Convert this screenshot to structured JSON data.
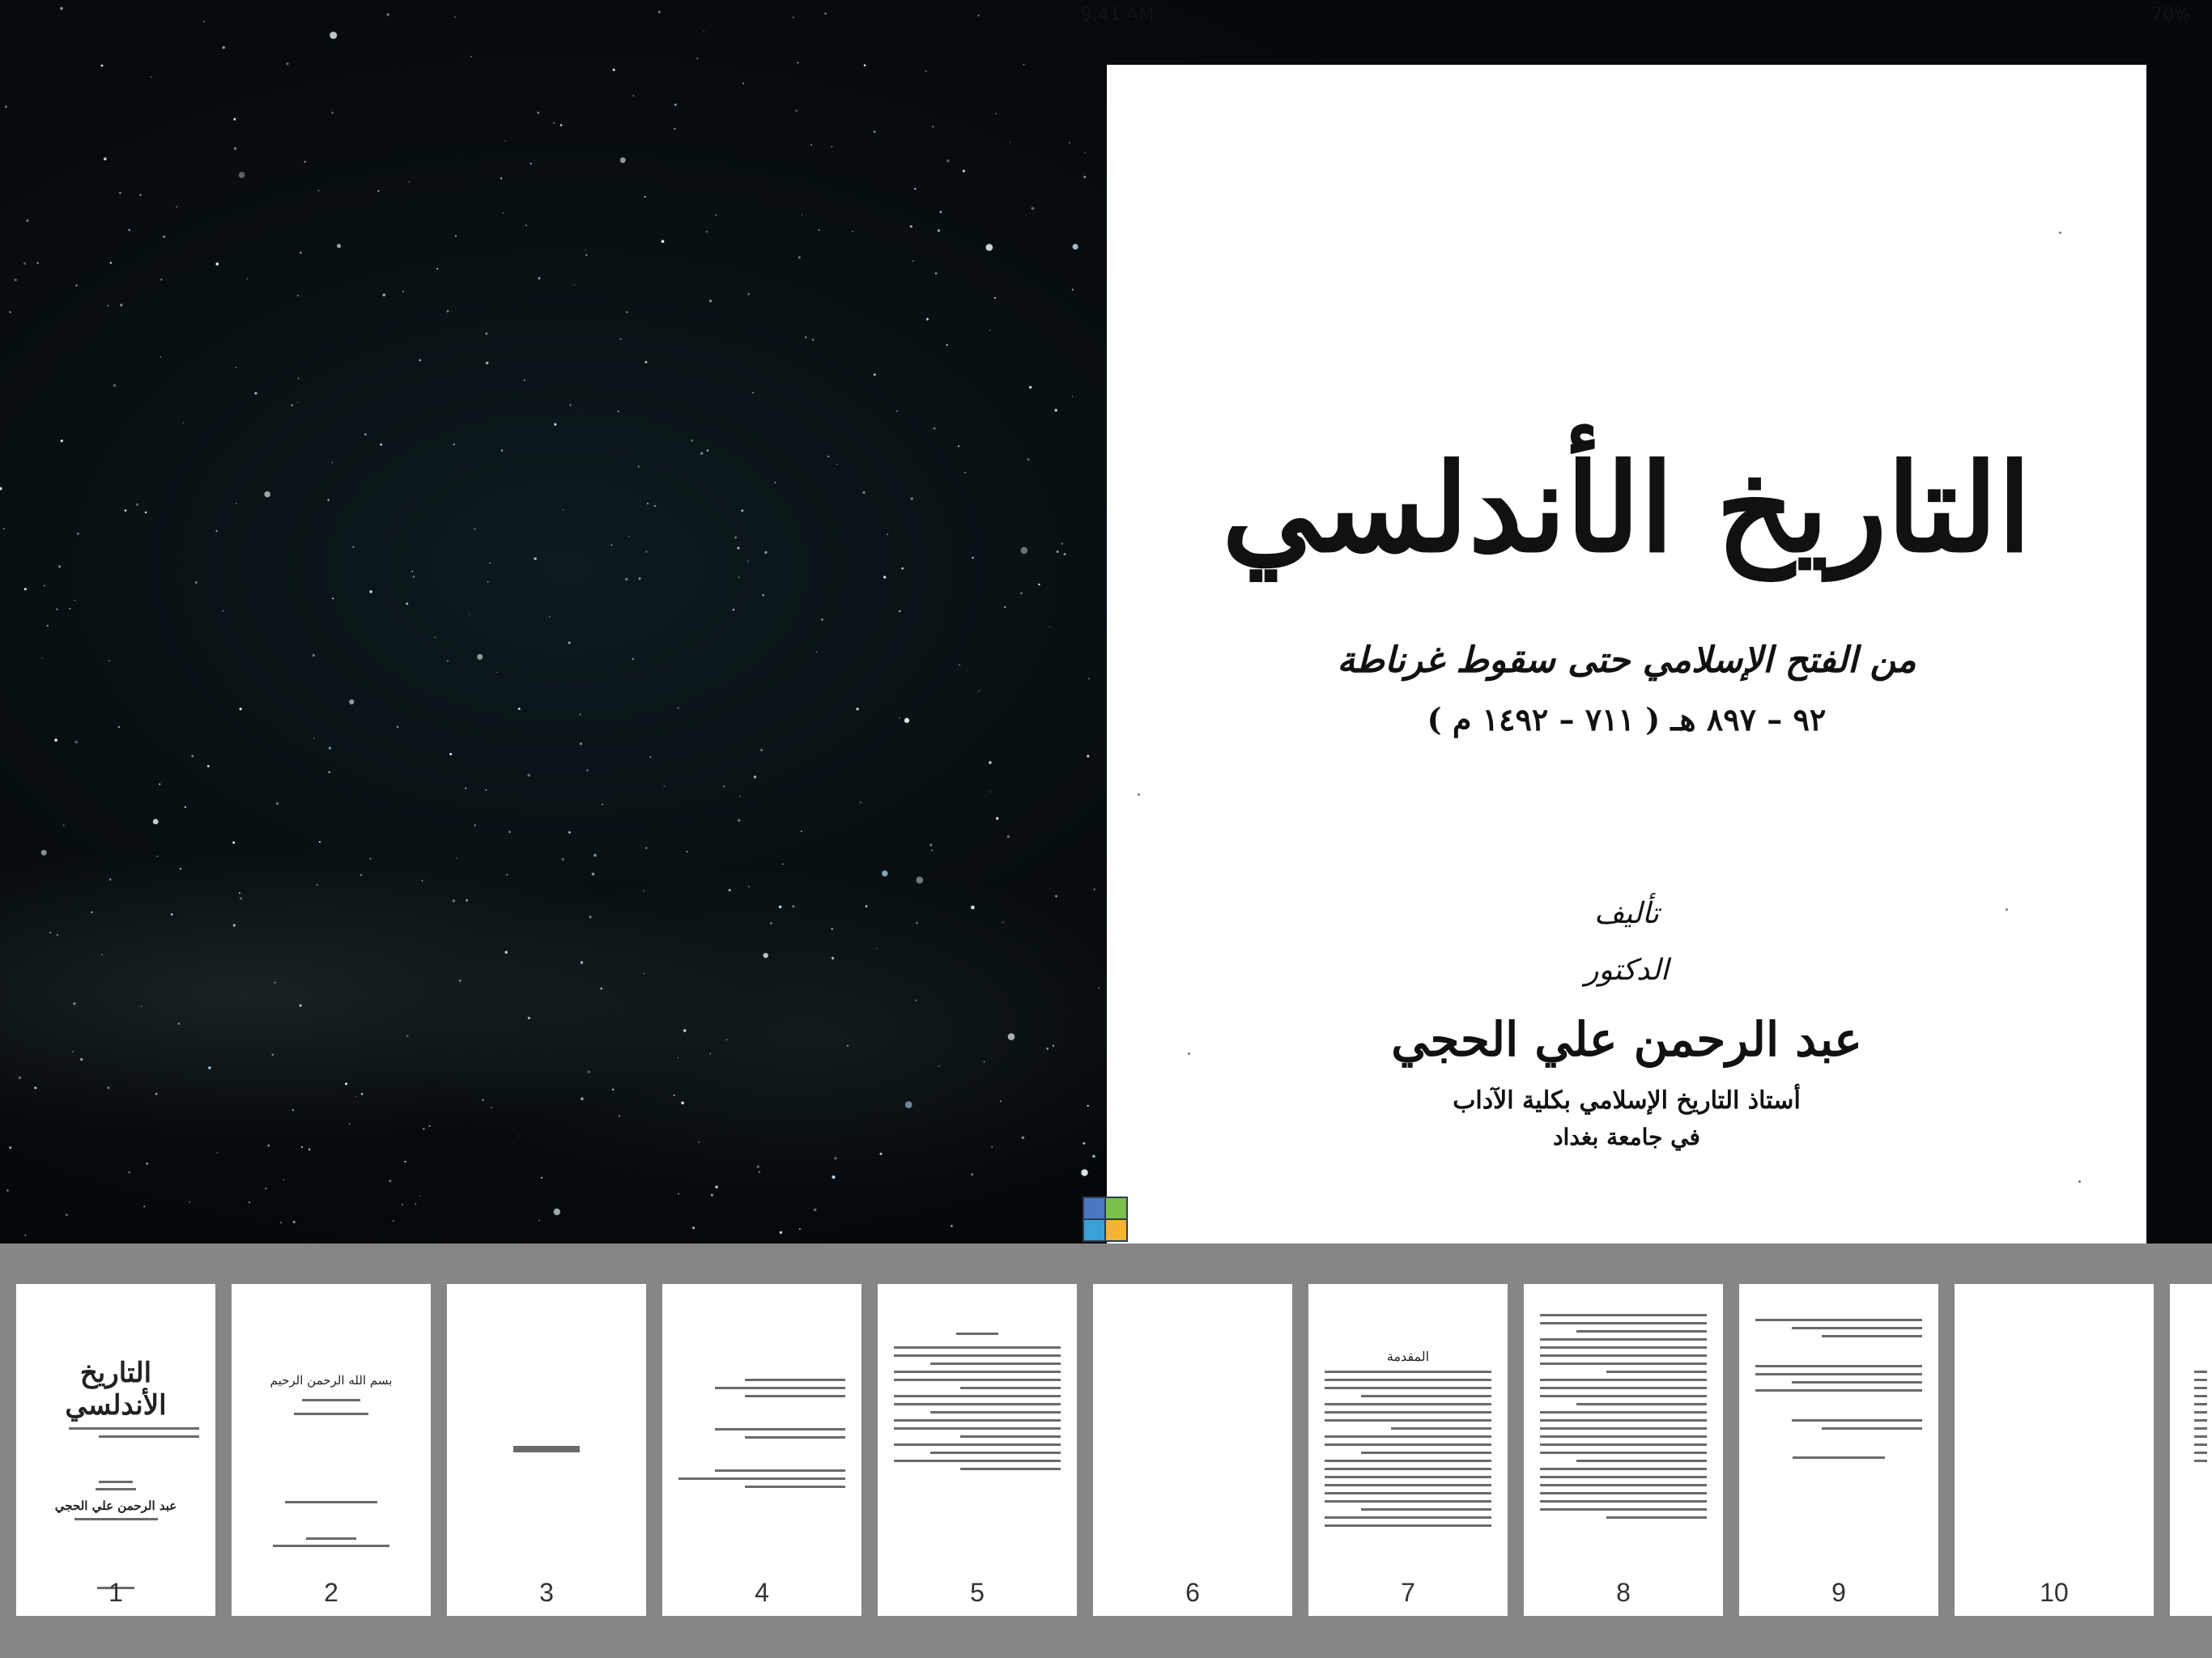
{
  "status_bar": {
    "time": "9:41 AM",
    "battery": "70%"
  },
  "page": {
    "title": "التاريخ الأندلسي",
    "subtitle": "من الفتح الإسلامي حتى سقوط غرناطة",
    "dates": "٩٢ – ٨٩٧ هـ ( ٧١١ – ١٤٩٢ م )",
    "authored_by": "تأليف",
    "doctor": "الدكتور",
    "author": "عبد الرحمن علي الحجي",
    "position": "أستاذ التاريخ الإسلامي بكلية الآداب",
    "university": "في جامعة بغداد"
  },
  "app_logo": {
    "icon": "app-logo-icon",
    "colors": [
      "#4a78c0",
      "#7cc04a",
      "#3aa0d8",
      "#f2b431"
    ]
  },
  "thumbnails": [
    {
      "label": "1",
      "kind": "cover"
    },
    {
      "label": "2",
      "kind": "sparse"
    },
    {
      "label": "3",
      "kind": "single"
    },
    {
      "label": "4",
      "kind": "list"
    },
    {
      "label": "5",
      "kind": "dense"
    },
    {
      "label": "6",
      "kind": "blank"
    },
    {
      "label": "7",
      "kind": "text"
    },
    {
      "label": "8",
      "kind": "dense"
    },
    {
      "label": "9",
      "kind": "short"
    },
    {
      "label": "10",
      "kind": "blank"
    }
  ],
  "thumb_mini": {
    "cover_title": "التاريخ الأندلسي",
    "cover_author": "عبد الرحمن علي الحجي",
    "basmala": "بسم الله الرحمن الرحيم",
    "page7_heading": "المقدمة"
  }
}
